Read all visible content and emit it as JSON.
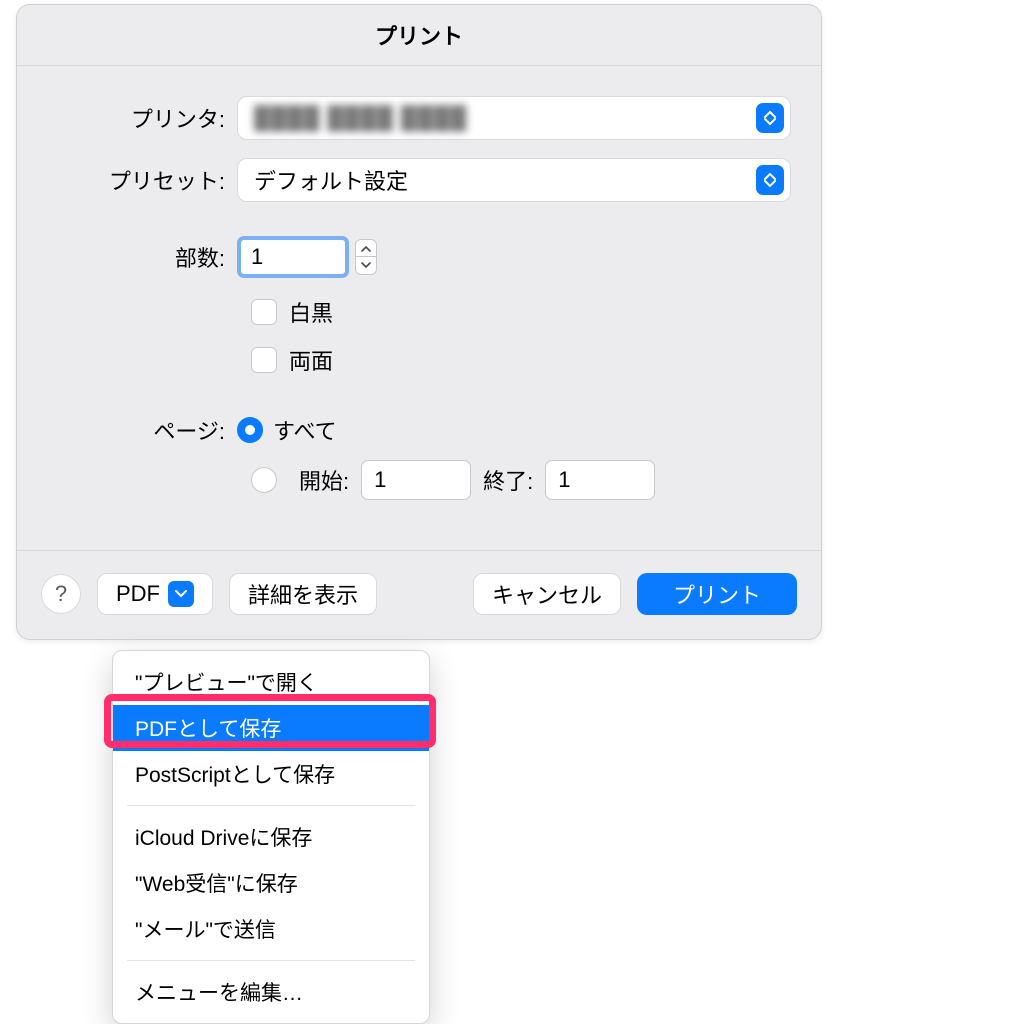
{
  "dialog": {
    "title": "プリント",
    "printer_label": "プリンタ:",
    "printer_value_blurred": "████ ████ ████",
    "preset_label": "プリセット:",
    "preset_value": "デフォルト設定",
    "copies_label": "部数:",
    "copies_value": "1",
    "bw_label": "白黒",
    "duplex_label": "両面",
    "pages_label": "ページ:",
    "pages_all": "すべて",
    "pages_from_label": "開始:",
    "pages_from_value": "1",
    "pages_to_label": "終了:",
    "pages_to_value": "1"
  },
  "footer": {
    "help": "?",
    "pdf": "PDF",
    "details": "詳細を表示",
    "cancel": "キャンセル",
    "print": "プリント"
  },
  "menu": {
    "open_in_preview": "\"プレビュー\"で開く",
    "save_as_pdf": "PDFとして保存",
    "save_as_postscript": "PostScriptとして保存",
    "save_to_icloud": "iCloud Driveに保存",
    "save_to_web": "\"Web受信\"に保存",
    "send_in_mail": "\"メール\"で送信",
    "edit_menu": "メニューを編集…"
  }
}
